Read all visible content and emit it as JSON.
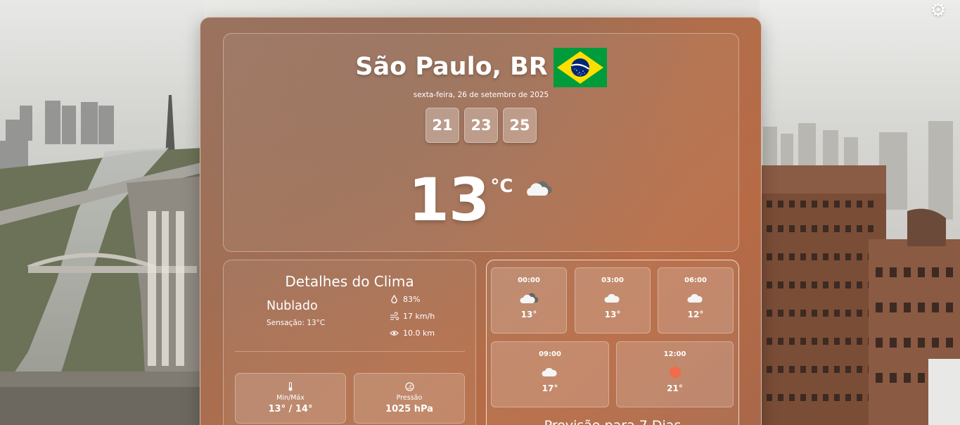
{
  "header": {
    "city": "São Paulo, BR",
    "date": "sexta-feira, 26 de setembro de 2025",
    "clock": {
      "hours": "21",
      "minutes": "23",
      "seconds": "25"
    }
  },
  "current": {
    "temperature": "13",
    "unit": "°C",
    "icon": "cloudy-icon"
  },
  "details": {
    "title": "Detalhes do Clima",
    "condition": "Nublado",
    "feels_like": "Sensação: 13°C",
    "humidity": "83%",
    "wind": "17 km/h",
    "visibility": "10.0 km",
    "minmax_label": "Min/Máx",
    "minmax_value": "13° / 14°",
    "pressure_label": "Pressão",
    "pressure_value": "1025 hPa"
  },
  "hourly": [
    {
      "time": "00:00",
      "temp": "13°",
      "icon": "cloudy-night-icon"
    },
    {
      "time": "03:00",
      "temp": "13°",
      "icon": "cloud-icon"
    },
    {
      "time": "06:00",
      "temp": "12°",
      "icon": "cloud-icon"
    },
    {
      "time": "09:00",
      "temp": "17°",
      "icon": "cloud-icon"
    },
    {
      "time": "12:00",
      "temp": "21°",
      "icon": "sun-icon"
    }
  ],
  "forecast_title": "Previsão para 7 Dias",
  "colors": {
    "card": "#a86d50",
    "sun": "#f26b4a"
  }
}
